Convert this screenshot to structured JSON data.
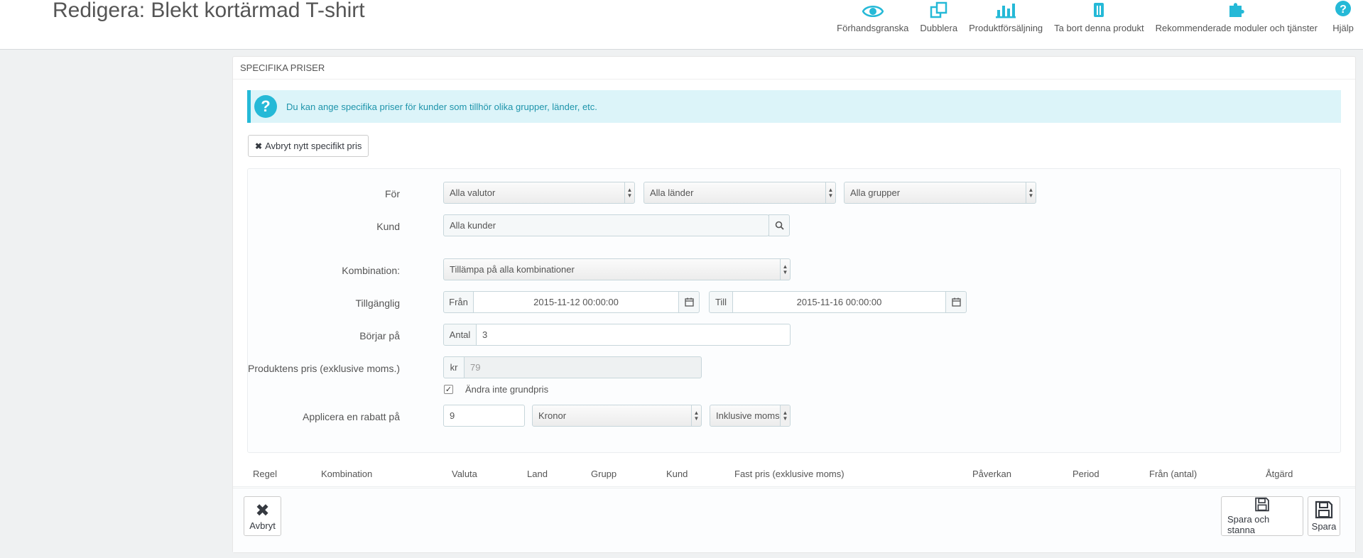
{
  "header": {
    "title": "Redigera: Blekt kortärmad T-shirt",
    "toolbar": [
      {
        "label": "Förhandsgranska",
        "icon": "eye-icon"
      },
      {
        "label": "Dubblera",
        "icon": "copy-icon"
      },
      {
        "label": "Produktförsäljning",
        "icon": "bar-chart-icon"
      },
      {
        "label": "Ta bort denna produkt",
        "icon": "trash-icon"
      },
      {
        "label": "Rekommenderade moduler och tjänster",
        "icon": "puzzle-icon"
      },
      {
        "label": "Hjälp",
        "icon": "help-icon"
      }
    ]
  },
  "panel": {
    "heading": "SPECIFIKA PRISER",
    "info": "Du kan ange specifika priser för kunder som tillhör olika grupper, länder, etc.",
    "cancel_new": "Avbryt nytt specifikt pris"
  },
  "form": {
    "for_label": "För",
    "currency": "Alla valutor",
    "country": "Alla länder",
    "group": "Alla grupper",
    "customer_label": "Kund",
    "customer": "Alla kunder",
    "combination_label": "Kombination:",
    "combination": "Tillämpa på alla kombinationer",
    "available_label": "Tillgänglig",
    "from_label": "Från",
    "from_value": "2015-11-12 00:00:00",
    "to_label": "Till",
    "to_value": "2015-11-16 00:00:00",
    "starts_label": "Börjar på",
    "quantity_label": "Antal",
    "quantity": "3",
    "price_label": "Produktens pris (exklusive moms.)",
    "currency_symbol": "kr",
    "price_placeholder": "79",
    "keep_base_price": "Ändra inte grundpris",
    "discount_label": "Applicera en rabatt på",
    "discount_value": "9",
    "discount_type": "Kronor",
    "tax_type": "Inklusive moms"
  },
  "table": {
    "columns": [
      "Regel",
      "Kombination",
      "Valuta",
      "Land",
      "Grupp",
      "Kund",
      "Fast pris (exklusive moms)",
      "Påverkan",
      "Period",
      "Från (antal)",
      "Åtgärd"
    ]
  },
  "footer": {
    "cancel": "Avbryt",
    "save_stay": "Spara och stanna",
    "save": "Spara"
  },
  "colors": {
    "accent": "#25b9d7",
    "info_bg": "#dcf4f9",
    "info_text": "#1e94ab"
  }
}
